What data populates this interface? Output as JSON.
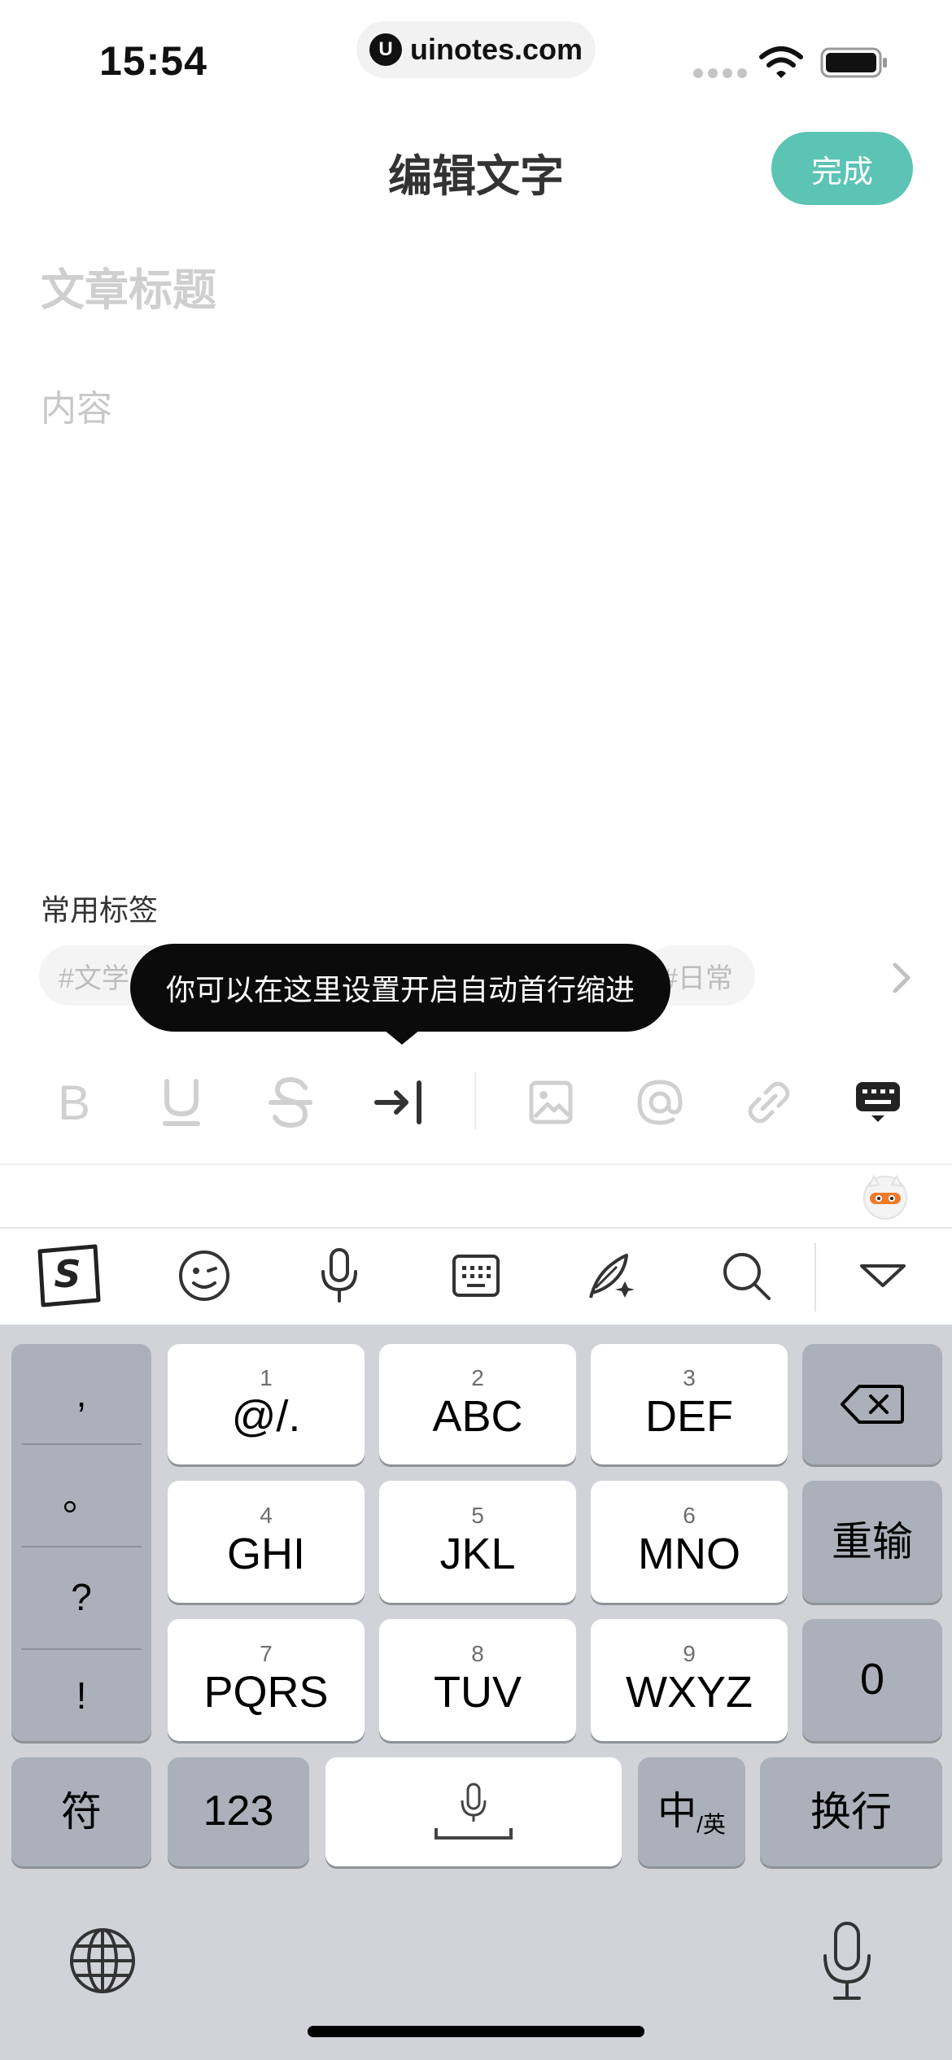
{
  "status_bar": {
    "time": "15:54",
    "url": "uinotes.com",
    "url_logo": "U"
  },
  "header": {
    "title": "编辑文字",
    "done_label": "完成"
  },
  "editor": {
    "title_placeholder": "文章标题",
    "content_placeholder": "内容"
  },
  "tags": {
    "label": "常用标签",
    "items": [
      "#文学",
      "#日常"
    ]
  },
  "tooltip": {
    "text": "你可以在这里设置开启自动首行缩进"
  },
  "format_toolbar": {
    "icons": [
      "bold-icon",
      "underline-icon",
      "strikethrough-icon",
      "indent-icon",
      "image-icon",
      "mention-icon",
      "link-icon",
      "keyboard-toggle-icon"
    ],
    "bold_glyph": "B"
  },
  "ime_bar": {
    "icons": [
      "sogou-logo-icon",
      "emoji-icon",
      "voice-icon",
      "keyboard-icon",
      "handwriting-icon",
      "search-icon",
      "collapse-icon"
    ],
    "logo_letter": "S"
  },
  "keyboard": {
    "punctuation": [
      ",",
      "。",
      "?",
      "!"
    ],
    "keys": [
      {
        "num": "1",
        "label": "@/."
      },
      {
        "num": "2",
        "label": "ABC"
      },
      {
        "num": "3",
        "label": "DEF"
      },
      {
        "num": "4",
        "label": "GHI"
      },
      {
        "num": "5",
        "label": "JKL"
      },
      {
        "num": "6",
        "label": "MNO"
      },
      {
        "num": "7",
        "label": "PQRS"
      },
      {
        "num": "8",
        "label": "TUV"
      },
      {
        "num": "9",
        "label": "WXYZ"
      }
    ],
    "retype_label": "重输",
    "zero_label": "0",
    "symbol_label": "符",
    "numbers_label": "123",
    "lang_label": "中",
    "lang_sub_label": "/英",
    "return_label": "换行"
  },
  "colors": {
    "accent": "#5cc4b4",
    "keyboard_bg": "#d1d3d9",
    "key_dark": "#acb0bb"
  }
}
